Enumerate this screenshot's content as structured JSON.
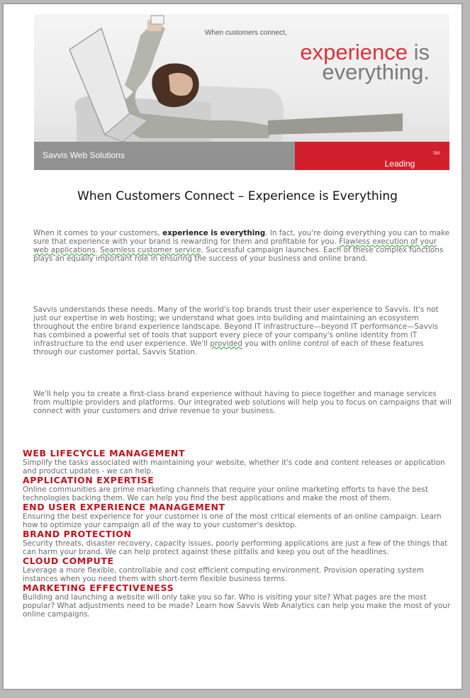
{
  "hero": {
    "tagline_small": "When customers connect,",
    "tagline_word1": "experience",
    "tagline_word2": " is",
    "tagline_line2": "everything.",
    "left_bar": "Savvis Web Solutions",
    "right_bar": "Leading Brand Experience.",
    "right_bar_mark": "SM"
  },
  "title": "When Customers Connect – Experience is Everything",
  "intro": {
    "p1_a": "When it comes to your customers, ",
    "p1_bold": "experience is everything",
    "p1_b": ". In fact, you're doing everything you can to make sure that experience with your brand is rewarding for them and profitable for you. ",
    "p1_squiggle1": "Flawless execution of your web applications",
    "p1_c": ". ",
    "p1_squiggle2": "Seamless customer service",
    "p1_d": ". Successful campaign launches. Each of these complex functions plays an equally important role in ensuring the success of your business and online brand.",
    "p2_a": "Savvis understands these needs. Many of the world's top brands trust their user experience to Savvis. It's not just our expertise in web hosting; we understand what goes into building and maintaining an ecosystem throughout the entire brand experience landscape. Beyond IT infrastructure—beyond IT performance—Savvis has combined a powerful set of tools that support every piece of your company's online identity from IT infrastructure to the end user experience. We'll ",
    "p2_squiggle": "provided",
    "p2_b": " you with online control of each of these features through our customer portal, Savvis Station.",
    "p3": "We'll help you to create a first-class brand experience without having to piece together and manage services from multiple providers and platforms. Our integrated web solutions will help you to focus on campaigns that will connect with your customers and drive revenue to your business."
  },
  "sections": [
    {
      "title": "WEB LIFECYCLE MANAGEMENT",
      "body": "Simplify the tasks associated with maintaining your website, whether it's code and content releases or application and product updates - we can help."
    },
    {
      "title": "APPLICATION EXPERTISE",
      "body": "Online communities are prime marketing channels that require your online marketing efforts to have the best technologies backing them. We can help you find the best applications and make the most of them."
    },
    {
      "title": "END USER EXPERIENCE MANAGEMENT",
      "body": "Ensuring the best experience for your customer is one of the most critical elements of an online campaign. Learn how to optimize your campaign all of the way to your customer's desktop."
    },
    {
      "title": "BRAND PROTECTION",
      "body": "Security threats, disaster recovery, capacity issues, poorly performing applications are just a few of the things that can harm your brand. We can help protect against these pitfalls and keep you out of the headlines."
    },
    {
      "title": "CLOUD COMPUTE",
      "body": "Leverage a more flexible, controllable and cost efficient computing environment. Provision operating system instances when you need them with short-term flexible business terms."
    },
    {
      "title": "MARKETING EFFECTIVENESS",
      "body": "Building and launching a website will only take you so far. Who is visiting your site? What pages are the most popular? What adjustments need to be made? Learn how Savvis Web Analytics can help you make the most of your online campaigns."
    }
  ],
  "colors": {
    "accent_red": "#c0121e",
    "banner_red": "#d21f2c",
    "body_gray": "#6a6a6a"
  }
}
